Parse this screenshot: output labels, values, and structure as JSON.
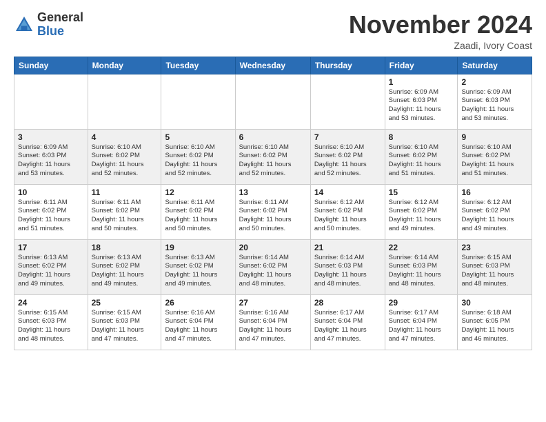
{
  "header": {
    "logo_line1": "General",
    "logo_line2": "Blue",
    "month_title": "November 2024",
    "location": "Zaadi, Ivory Coast"
  },
  "weekdays": [
    "Sunday",
    "Monday",
    "Tuesday",
    "Wednesday",
    "Thursday",
    "Friday",
    "Saturday"
  ],
  "weeks": [
    [
      {
        "day": "",
        "info": ""
      },
      {
        "day": "",
        "info": ""
      },
      {
        "day": "",
        "info": ""
      },
      {
        "day": "",
        "info": ""
      },
      {
        "day": "",
        "info": ""
      },
      {
        "day": "1",
        "info": "Sunrise: 6:09 AM\nSunset: 6:03 PM\nDaylight: 11 hours\nand 53 minutes."
      },
      {
        "day": "2",
        "info": "Sunrise: 6:09 AM\nSunset: 6:03 PM\nDaylight: 11 hours\nand 53 minutes."
      }
    ],
    [
      {
        "day": "3",
        "info": "Sunrise: 6:09 AM\nSunset: 6:03 PM\nDaylight: 11 hours\nand 53 minutes."
      },
      {
        "day": "4",
        "info": "Sunrise: 6:10 AM\nSunset: 6:02 PM\nDaylight: 11 hours\nand 52 minutes."
      },
      {
        "day": "5",
        "info": "Sunrise: 6:10 AM\nSunset: 6:02 PM\nDaylight: 11 hours\nand 52 minutes."
      },
      {
        "day": "6",
        "info": "Sunrise: 6:10 AM\nSunset: 6:02 PM\nDaylight: 11 hours\nand 52 minutes."
      },
      {
        "day": "7",
        "info": "Sunrise: 6:10 AM\nSunset: 6:02 PM\nDaylight: 11 hours\nand 52 minutes."
      },
      {
        "day": "8",
        "info": "Sunrise: 6:10 AM\nSunset: 6:02 PM\nDaylight: 11 hours\nand 51 minutes."
      },
      {
        "day": "9",
        "info": "Sunrise: 6:10 AM\nSunset: 6:02 PM\nDaylight: 11 hours\nand 51 minutes."
      }
    ],
    [
      {
        "day": "10",
        "info": "Sunrise: 6:11 AM\nSunset: 6:02 PM\nDaylight: 11 hours\nand 51 minutes."
      },
      {
        "day": "11",
        "info": "Sunrise: 6:11 AM\nSunset: 6:02 PM\nDaylight: 11 hours\nand 50 minutes."
      },
      {
        "day": "12",
        "info": "Sunrise: 6:11 AM\nSunset: 6:02 PM\nDaylight: 11 hours\nand 50 minutes."
      },
      {
        "day": "13",
        "info": "Sunrise: 6:11 AM\nSunset: 6:02 PM\nDaylight: 11 hours\nand 50 minutes."
      },
      {
        "day": "14",
        "info": "Sunrise: 6:12 AM\nSunset: 6:02 PM\nDaylight: 11 hours\nand 50 minutes."
      },
      {
        "day": "15",
        "info": "Sunrise: 6:12 AM\nSunset: 6:02 PM\nDaylight: 11 hours\nand 49 minutes."
      },
      {
        "day": "16",
        "info": "Sunrise: 6:12 AM\nSunset: 6:02 PM\nDaylight: 11 hours\nand 49 minutes."
      }
    ],
    [
      {
        "day": "17",
        "info": "Sunrise: 6:13 AM\nSunset: 6:02 PM\nDaylight: 11 hours\nand 49 minutes."
      },
      {
        "day": "18",
        "info": "Sunrise: 6:13 AM\nSunset: 6:02 PM\nDaylight: 11 hours\nand 49 minutes."
      },
      {
        "day": "19",
        "info": "Sunrise: 6:13 AM\nSunset: 6:02 PM\nDaylight: 11 hours\nand 49 minutes."
      },
      {
        "day": "20",
        "info": "Sunrise: 6:14 AM\nSunset: 6:02 PM\nDaylight: 11 hours\nand 48 minutes."
      },
      {
        "day": "21",
        "info": "Sunrise: 6:14 AM\nSunset: 6:03 PM\nDaylight: 11 hours\nand 48 minutes."
      },
      {
        "day": "22",
        "info": "Sunrise: 6:14 AM\nSunset: 6:03 PM\nDaylight: 11 hours\nand 48 minutes."
      },
      {
        "day": "23",
        "info": "Sunrise: 6:15 AM\nSunset: 6:03 PM\nDaylight: 11 hours\nand 48 minutes."
      }
    ],
    [
      {
        "day": "24",
        "info": "Sunrise: 6:15 AM\nSunset: 6:03 PM\nDaylight: 11 hours\nand 48 minutes."
      },
      {
        "day": "25",
        "info": "Sunrise: 6:15 AM\nSunset: 6:03 PM\nDaylight: 11 hours\nand 47 minutes."
      },
      {
        "day": "26",
        "info": "Sunrise: 6:16 AM\nSunset: 6:04 PM\nDaylight: 11 hours\nand 47 minutes."
      },
      {
        "day": "27",
        "info": "Sunrise: 6:16 AM\nSunset: 6:04 PM\nDaylight: 11 hours\nand 47 minutes."
      },
      {
        "day": "28",
        "info": "Sunrise: 6:17 AM\nSunset: 6:04 PM\nDaylight: 11 hours\nand 47 minutes."
      },
      {
        "day": "29",
        "info": "Sunrise: 6:17 AM\nSunset: 6:04 PM\nDaylight: 11 hours\nand 47 minutes."
      },
      {
        "day": "30",
        "info": "Sunrise: 6:18 AM\nSunset: 6:05 PM\nDaylight: 11 hours\nand 46 minutes."
      }
    ]
  ]
}
